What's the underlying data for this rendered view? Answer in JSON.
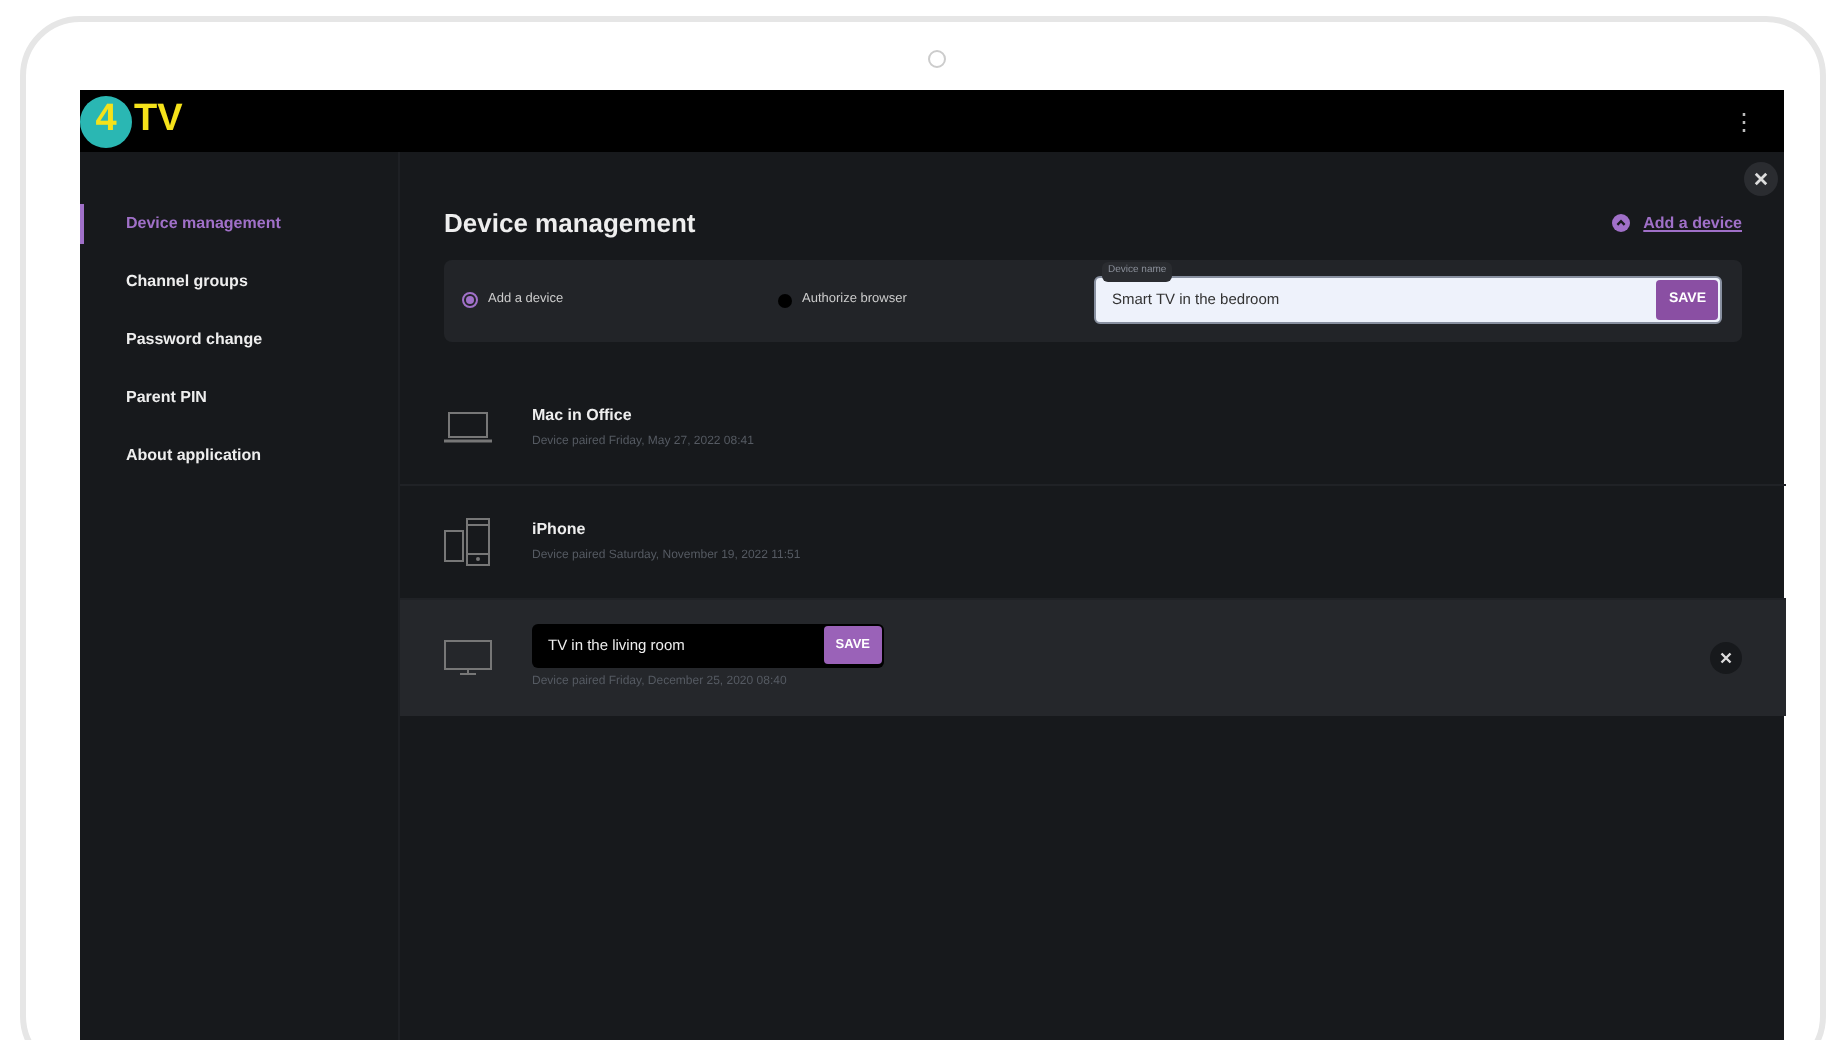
{
  "logo": {
    "badge": "4",
    "text": "TV"
  },
  "menu_icon": "⋮",
  "sidebar": {
    "items": [
      {
        "label": "Device management",
        "selected": true
      },
      {
        "label": "Channel groups",
        "selected": false
      },
      {
        "label": "Password change",
        "selected": false
      },
      {
        "label": "Parent PIN",
        "selected": false
      },
      {
        "label": "About application",
        "selected": false
      }
    ]
  },
  "page": {
    "title": "Device management",
    "add_link": "Add a device"
  },
  "add_panel": {
    "options": [
      {
        "label": "Add a device",
        "selected": true
      },
      {
        "label": "Authorize browser",
        "selected": false
      }
    ],
    "field": {
      "label": "Device name",
      "value": "Smart TV in the bedroom",
      "button": "SAVE"
    }
  },
  "devices": [
    {
      "kind": "laptop",
      "name": "Mac in Office",
      "paired": "Device paired Friday, May 27, 2022 08:41",
      "editing": false
    },
    {
      "kind": "phone",
      "name": "iPhone",
      "paired": "Device paired Saturday, November 19, 2022 11:51",
      "editing": false
    },
    {
      "kind": "tv",
      "name": "TV in the living room",
      "paired": "Device paired Friday, December 25, 2020 08:40",
      "editing": true,
      "button": "SAVE"
    }
  ]
}
